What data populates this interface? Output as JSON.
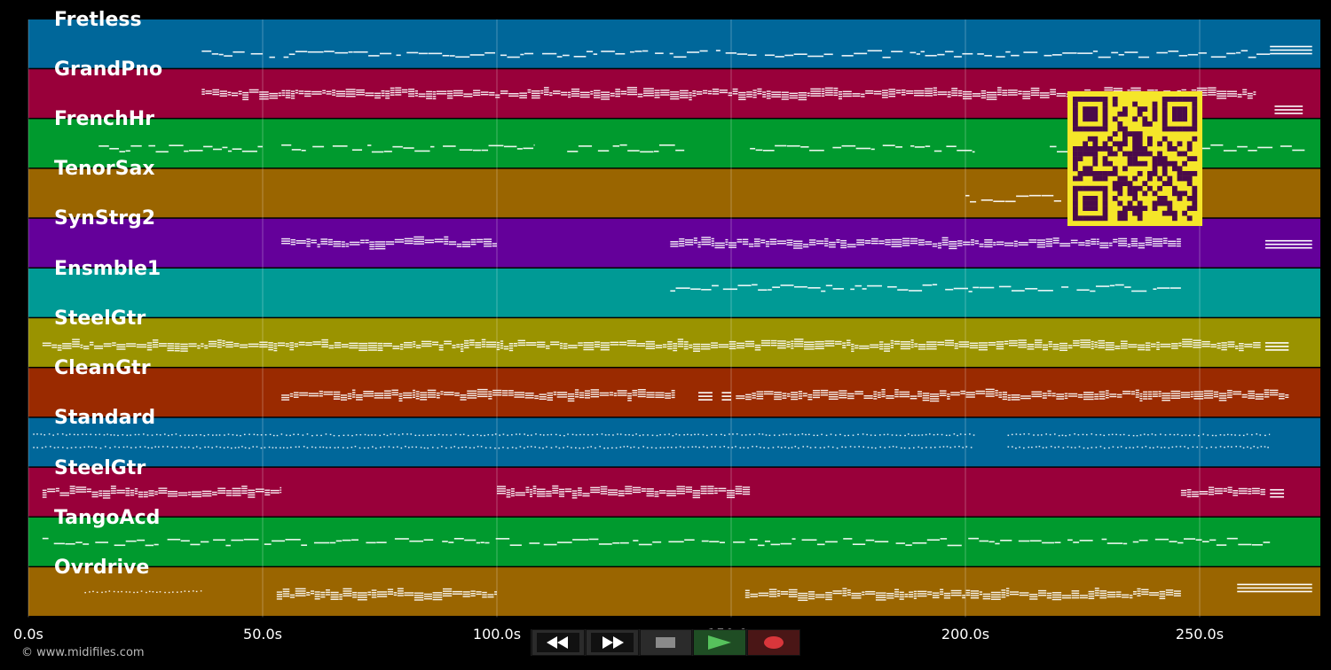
{
  "lanes": [
    {
      "label": "Fretless",
      "color": "#00679a"
    },
    {
      "label": "GrandPno",
      "color": "#99003a"
    },
    {
      "label": "FrenchHr",
      "color": "#009a2e"
    },
    {
      "label": "TenorSax",
      "color": "#9a6500"
    },
    {
      "label": "SynStrg2",
      "color": "#64009a"
    },
    {
      "label": "Ensmble1",
      "color": "#009a95"
    },
    {
      "label": "SteelGtr",
      "color": "#9a9300"
    },
    {
      "label": "CleanGtr",
      "color": "#9a2a00"
    },
    {
      "label": "Standard",
      "color": "#00679a"
    },
    {
      "label": "SteelGtr",
      "color": "#99003a"
    },
    {
      "label": "TangoAcd",
      "color": "#009a2e"
    },
    {
      "label": "Ovrdrive",
      "color": "#9a6500"
    }
  ],
  "time_axis": {
    "ticks": [
      "0.0s",
      "50.0s",
      "100.0s",
      "150.0s",
      "200.0s",
      "250.0s"
    ],
    "tick_values": [
      0,
      50,
      100,
      150,
      200,
      250
    ],
    "max_seconds": 275
  },
  "transport": {
    "buttons": [
      {
        "name": "rewind-button",
        "icon": "rewind-icon"
      },
      {
        "name": "fast-forward-button",
        "icon": "fast-forward-icon"
      },
      {
        "name": "stop-button",
        "icon": "stop-icon"
      },
      {
        "name": "play-button",
        "icon": "play-icon"
      },
      {
        "name": "record-button",
        "icon": "record-icon"
      }
    ],
    "colors": {
      "play": "#4caf50",
      "record": "#d32f2f",
      "stop": "#888888"
    }
  },
  "copyright": "© www.midifiles.com",
  "qr": {
    "fg": "#4a0a4a",
    "bg": "#f5e629"
  },
  "note_segments": [
    [
      [
        37,
        265,
        0.7,
        "melody"
      ],
      [
        265,
        274,
        0.6,
        "block"
      ]
    ],
    [
      [
        37,
        262,
        0.5,
        "dense"
      ],
      [
        266,
        272,
        0.8,
        "block"
      ]
    ],
    [
      [
        15,
        50,
        0.6,
        "melody"
      ],
      [
        54,
        108,
        0.6,
        "melody"
      ],
      [
        115,
        140,
        0.6,
        "melody"
      ],
      [
        154,
        202,
        0.6,
        "melody"
      ],
      [
        218,
        274,
        0.6,
        "melody"
      ]
    ],
    [
      [
        200,
        222,
        0.6,
        "melody"
      ]
    ],
    [
      [
        54,
        100,
        0.5,
        "dense"
      ],
      [
        137,
        246,
        0.5,
        "dense"
      ],
      [
        264,
        274,
        0.5,
        "block"
      ]
    ],
    [
      [
        137,
        246,
        0.4,
        "melody"
      ]
    ],
    [
      [
        3,
        263,
        0.55,
        "dense"
      ],
      [
        264,
        269,
        0.55,
        "block"
      ]
    ],
    [
      [
        54,
        138,
        0.55,
        "dense"
      ],
      [
        143,
        146,
        0.55,
        "block"
      ],
      [
        148,
        150,
        0.55,
        "block"
      ],
      [
        151,
        269,
        0.55,
        "dense"
      ]
    ],
    [
      [
        1,
        202,
        0.35,
        "dots"
      ],
      [
        1,
        202,
        0.6,
        "dots"
      ],
      [
        209,
        265,
        0.35,
        "dots"
      ],
      [
        209,
        265,
        0.6,
        "dots"
      ]
    ],
    [
      [
        3,
        54,
        0.5,
        "dense"
      ],
      [
        100,
        154,
        0.5,
        "dense"
      ],
      [
        246,
        264,
        0.5,
        "dense"
      ],
      [
        265,
        268,
        0.5,
        "block"
      ]
    ],
    [
      [
        3,
        265,
        0.5,
        "melody"
      ]
    ],
    [
      [
        12,
        37,
        0.5,
        "dots"
      ],
      [
        53,
        100,
        0.55,
        "dense"
      ],
      [
        153,
        246,
        0.55,
        "dense"
      ],
      [
        258,
        274,
        0.4,
        "block"
      ]
    ]
  ]
}
